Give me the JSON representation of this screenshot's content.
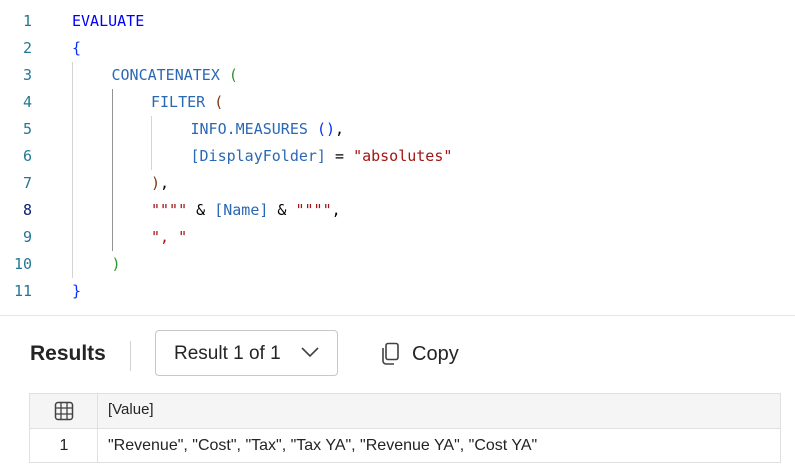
{
  "editor": {
    "line_numbers": [
      "1",
      "2",
      "3",
      "4",
      "5",
      "6",
      "7",
      "8",
      "9",
      "10",
      "11"
    ],
    "active_line": "8",
    "lines": [
      [
        {
          "t": "EVALUATE",
          "c": "kw"
        }
      ],
      [
        {
          "t": "{",
          "c": "p3"
        }
      ],
      [
        {
          "t": "CONCATENATEX",
          "c": "fn"
        },
        {
          "t": " ",
          "c": "txt"
        },
        {
          "t": "(",
          "c": "p1"
        }
      ],
      [
        {
          "t": "FILTER",
          "c": "fn"
        },
        {
          "t": " ",
          "c": "txt"
        },
        {
          "t": "(",
          "c": "p2"
        }
      ],
      [
        {
          "t": "INFO.MEASURES",
          "c": "fn"
        },
        {
          "t": " ",
          "c": "txt"
        },
        {
          "t": "()",
          "c": "p3"
        },
        {
          "t": ",",
          "c": "txt"
        }
      ],
      [
        {
          "t": "[DisplayFolder]",
          "c": "col"
        },
        {
          "t": " = ",
          "c": "txt"
        },
        {
          "t": "\"absolutes\"",
          "c": "str"
        }
      ],
      [
        {
          "t": ")",
          "c": "p2"
        },
        {
          "t": ",",
          "c": "txt"
        }
      ],
      [
        {
          "t": "\"\"\"\"",
          "c": "str"
        },
        {
          "t": " & ",
          "c": "txt"
        },
        {
          "t": "[Name]",
          "c": "col"
        },
        {
          "t": " & ",
          "c": "txt"
        },
        {
          "t": "\"\"\"\"",
          "c": "str"
        },
        {
          "t": ",",
          "c": "txt"
        }
      ],
      [
        {
          "t": "\", \"",
          "c": "str"
        }
      ],
      [
        {
          "t": ")",
          "c": "p1"
        }
      ],
      [
        {
          "t": "}",
          "c": "p3"
        }
      ]
    ],
    "indents": [
      0,
      0,
      1,
      2,
      3,
      3,
      2,
      2,
      2,
      1,
      0
    ]
  },
  "results": {
    "title": "Results",
    "selector_label": "Result 1 of 1",
    "copy_label": "Copy",
    "grid": {
      "column_header": "[Value]",
      "rows": [
        {
          "index": "1",
          "value": "\"Revenue\", \"Cost\", \"Tax\", \"Tax YA\", \"Revenue YA\", \"Cost YA\""
        }
      ]
    }
  },
  "icons": {
    "selector_chevron": "chevron-down-icon",
    "copy": "copy-icon",
    "grid_header": "table-icon"
  },
  "colors": {
    "keyword": "#0000ff",
    "function": "#2b68b4",
    "string": "#a31515",
    "line_number": "#237893",
    "bracket_level1": "#319331",
    "bracket_level2": "#7b3814",
    "bracket_level3": "#0431fa"
  }
}
